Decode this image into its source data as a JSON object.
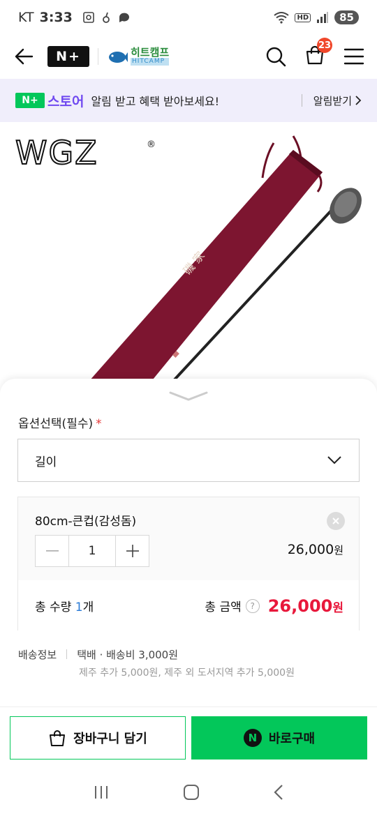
{
  "status": {
    "carrier": "KT",
    "time": "3:33",
    "battery": "85",
    "hd": "HD"
  },
  "header": {
    "brand": "N+",
    "shop_name_ko": "히트캠프",
    "shop_name_en": "HITCAMP",
    "cart_count": "23"
  },
  "notice": {
    "store_n": "N+",
    "store_name": "스토어",
    "message": "알림 받고 혜택 받아보세요!",
    "alarm_label": "알림받기"
  },
  "product": {
    "logo": "WGZ",
    "logo_mark": "®"
  },
  "options": {
    "label": "옵션선택(필수)",
    "required_mark": "*",
    "select_value": "길이",
    "item": {
      "name": "80cm-큰컵(감성돔)",
      "quantity": "1",
      "price": "26,000",
      "won": "원"
    },
    "total": {
      "qty_prefix": "총 수량 ",
      "qty_num": "1",
      "qty_suffix": "개",
      "amount_label": "총 금액",
      "help": "?",
      "amount": "26,000",
      "won": "원"
    }
  },
  "shipping": {
    "label": "배송정보",
    "method": "택배 · 배송비 3,000원",
    "extra": "제주 추가 5,000원, 제주 외 도서지역 추가 5,000원"
  },
  "actions": {
    "cart": "장바구니 담기",
    "buy": "바로구매",
    "buy_icon": "N"
  }
}
